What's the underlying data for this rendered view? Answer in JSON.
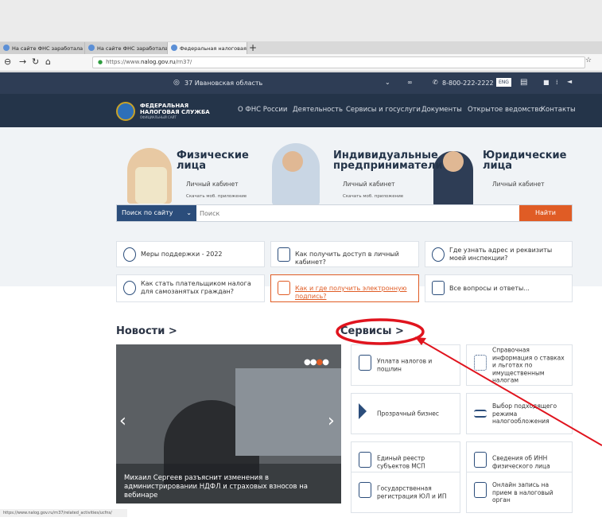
{
  "browser": {
    "tabs": [
      {
        "label": "На сайте ФНС заработала пр"
      },
      {
        "label": "На сайте ФНС заработала пр"
      },
      {
        "label": "Федеральная налоговая служ"
      }
    ],
    "new_tab": "+",
    "url_prefix": "https://www.",
    "url_domain": "nalog.gov.ru",
    "url_suffix": "/rn37/",
    "status_url": "https://www.nalog.gov.ru/rn37/related_activities/ucfns/"
  },
  "topbar": {
    "region": "37 Ивановская область",
    "phone": "8-800-222-2222",
    "lang": "ENG"
  },
  "header": {
    "logo_line1": "ФЕДЕРАЛЬНАЯ",
    "logo_line2": "НАЛОГОВАЯ СЛУЖБА",
    "logo_line3": "ОФИЦИАЛЬНЫЙ САЙТ",
    "menu": [
      "О ФНС России",
      "Деятельность",
      "Сервисы и госуслуги",
      "Документы",
      "Открытое ведомство",
      "Контакты"
    ]
  },
  "segments": [
    {
      "title1": "Физические",
      "title2": "лица",
      "link1": "Личный кабинет",
      "link2": "Скачать моб. приложение"
    },
    {
      "title1": "Индивидуальные",
      "title2": "предприниматели",
      "link1": "Личный кабинет",
      "link2": "Скачать моб. приложение"
    },
    {
      "title1": "Юридические",
      "title2": "лица",
      "link1": "Личный кабинет",
      "link2": ""
    }
  ],
  "search": {
    "select_label": "Поиск по сайту",
    "placeholder": "Поиск",
    "button": "Найти"
  },
  "quick_links": [
    {
      "text": "Меры поддержки - 2022"
    },
    {
      "text": "Как получить доступ в личный кабинет?"
    },
    {
      "text": "Где узнать адрес и реквизиты моей инспекции?"
    },
    {
      "text": "Как стать плательщиком налога для самозанятых граждан?"
    },
    {
      "text": "Как и где получить электронную подпись?"
    },
    {
      "text": "Все вопросы и ответы..."
    }
  ],
  "news": {
    "heading": "Новости >",
    "caption": "Михаил Сергеев разъяснит изменения в администрировании НДФЛ и страховых взносов на вебинаре"
  },
  "services": {
    "heading": "Сервисы >",
    "items": [
      {
        "text": "Уплата налогов и пошлин"
      },
      {
        "text": "Справочная информация о ставках и льготах по имущественным налогам"
      },
      {
        "text": "Прозрачный бизнес"
      },
      {
        "text": "Выбор подходящего режима налогообложения"
      },
      {
        "text": "Единый реестр субъектов МСП"
      },
      {
        "text": "Сведения об ИНН физического лица"
      },
      {
        "text": "Государственная регистрация ЮЛ и ИП"
      },
      {
        "text": "Онлайн запись на прием в налоговый орган"
      }
    ]
  },
  "colors": {
    "accent": "#e05c25",
    "navy": "#243449",
    "annotation": "#e0141e"
  }
}
